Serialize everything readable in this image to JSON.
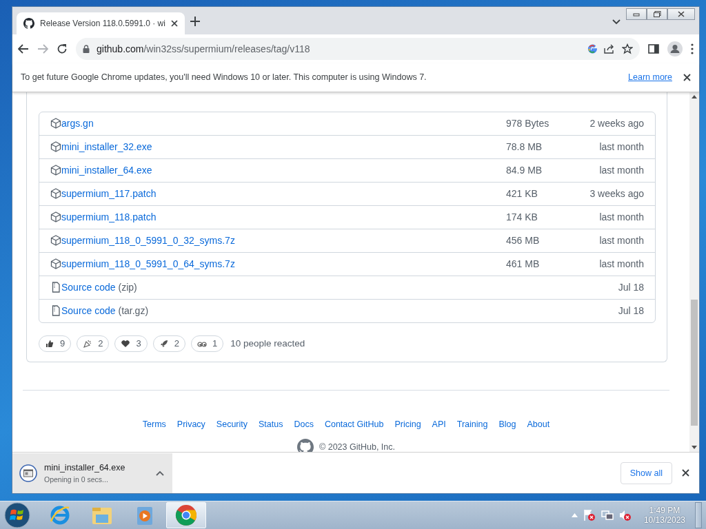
{
  "tab": {
    "title": "Release Version 118.0.5991.0 · wi",
    "selected": true
  },
  "address": {
    "host": "github.com",
    "path": "/win32ss/supermium/releases/tag/v118"
  },
  "infobar": {
    "message": "To get future Google Chrome updates, you'll need Windows 10 or later. This computer is using Windows 7.",
    "link": "Learn more"
  },
  "assets": [
    {
      "kind": "package",
      "name": "args.gn",
      "size": "978 Bytes",
      "time": "2 weeks ago"
    },
    {
      "kind": "package",
      "name": "mini_installer_32.exe",
      "size": "78.8 MB",
      "time": "last month"
    },
    {
      "kind": "package",
      "name": "mini_installer_64.exe",
      "size": "84.9 MB",
      "time": "last month"
    },
    {
      "kind": "package",
      "name": "supermium_117.patch",
      "size": "421 KB",
      "time": "3 weeks ago"
    },
    {
      "kind": "package",
      "name": "supermium_118.patch",
      "size": "174 KB",
      "time": "last month"
    },
    {
      "kind": "package",
      "name": "supermium_118_0_5991_0_32_syms.7z",
      "size": "456 MB",
      "time": "last month"
    },
    {
      "kind": "package",
      "name": "supermium_118_0_5991_0_64_syms.7z",
      "size": "461 MB",
      "time": "last month"
    },
    {
      "kind": "source",
      "name": "Source code",
      "format": "(zip)",
      "time": "Jul 18"
    },
    {
      "kind": "source",
      "name": "Source code",
      "format": "(tar.gz)",
      "time": "Jul 18"
    }
  ],
  "reactions": [
    {
      "kind": "thumbs-up",
      "count": "9"
    },
    {
      "kind": "party",
      "count": "2"
    },
    {
      "kind": "heart",
      "count": "3"
    },
    {
      "kind": "rocket",
      "count": "2"
    },
    {
      "kind": "eyes",
      "count": "1"
    }
  ],
  "reactions_summary": "10 people reacted",
  "footer": {
    "links": [
      "Terms",
      "Privacy",
      "Security",
      "Status",
      "Docs",
      "Contact GitHub",
      "Pricing",
      "API",
      "Training",
      "Blog",
      "About"
    ],
    "copyright": "© 2023 GitHub, Inc."
  },
  "download": {
    "filename": "mini_installer_64.exe",
    "status": "Opening in 0 secs...",
    "show_all": "Show all"
  },
  "taskbar": {
    "apps": [
      {
        "kind": "ie",
        "selected": false
      },
      {
        "kind": "explorer",
        "selected": false
      },
      {
        "kind": "media",
        "selected": false
      },
      {
        "kind": "chrome",
        "selected": true
      }
    ],
    "time": "1:49 PM",
    "date": "10/13/2023"
  }
}
